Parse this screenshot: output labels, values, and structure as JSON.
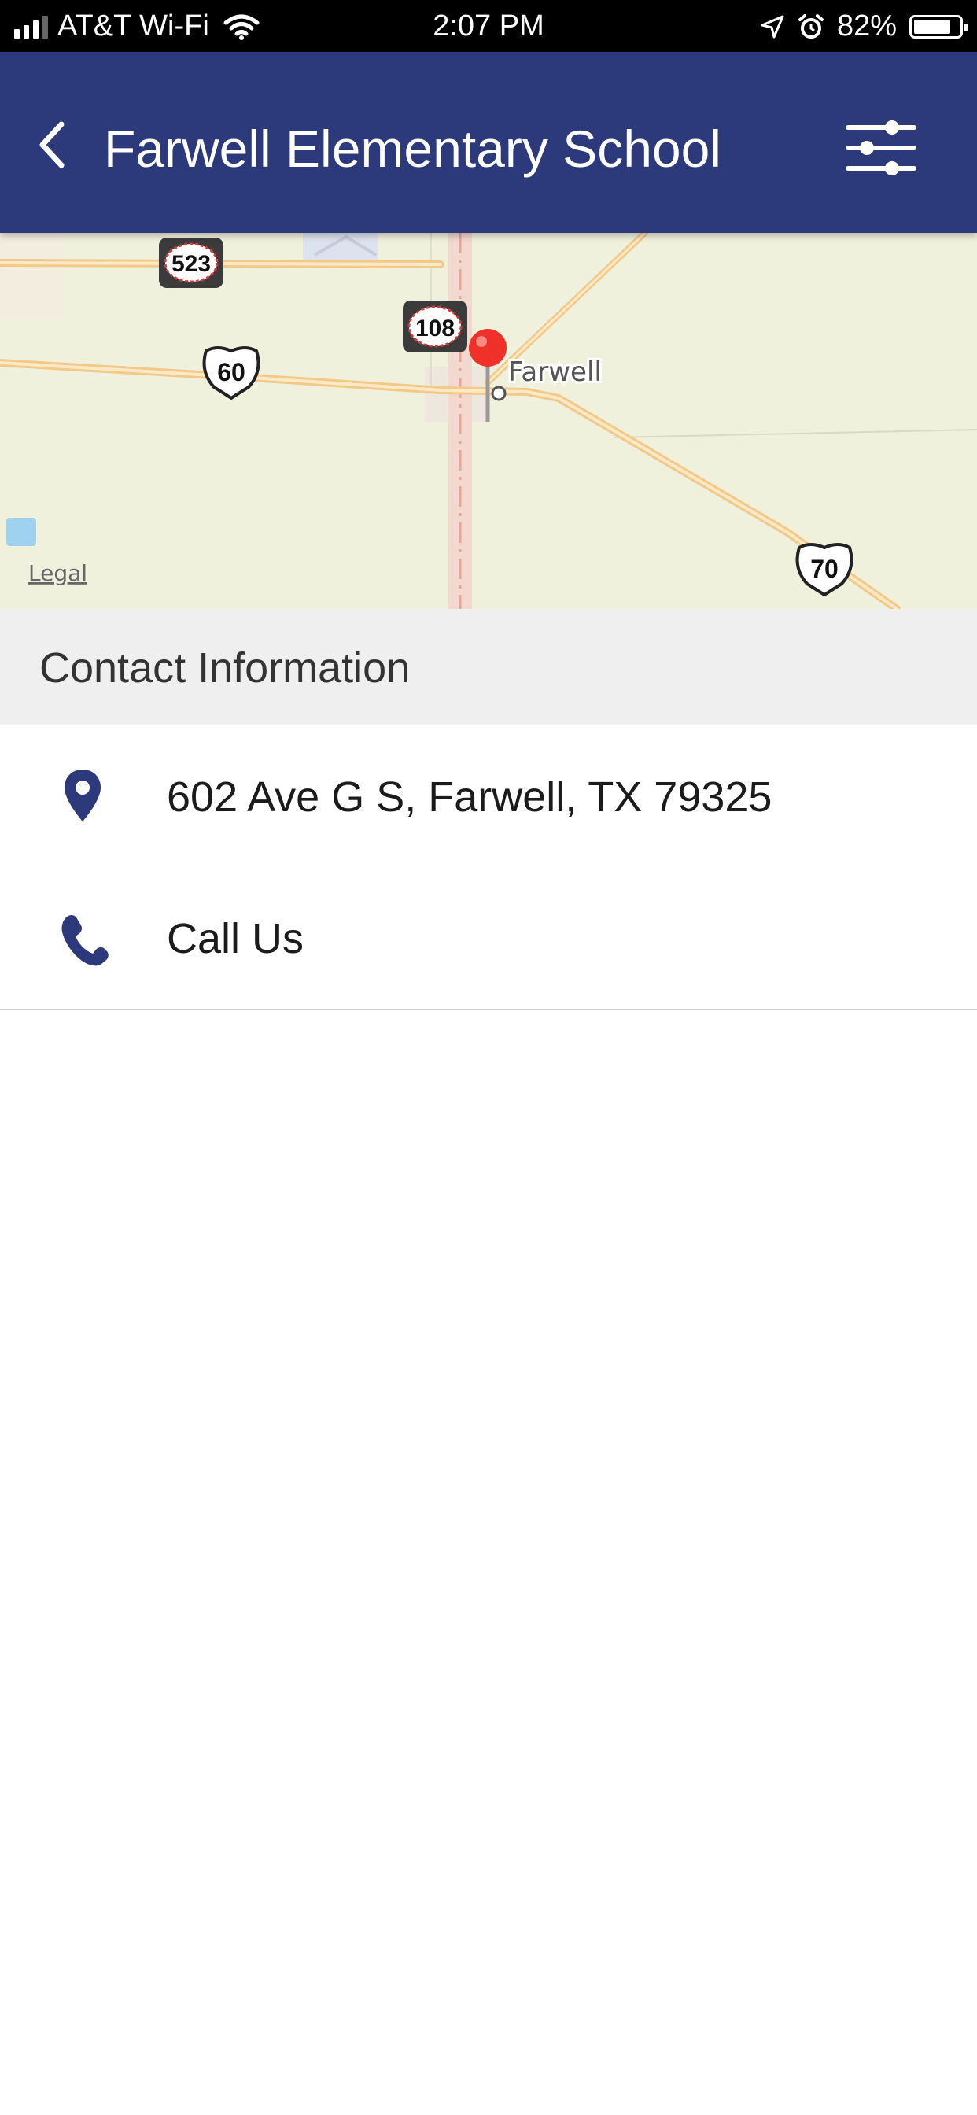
{
  "status_bar": {
    "carrier": "AT&T Wi-Fi",
    "time": "2:07 PM",
    "battery": "82%",
    "battery_level": 0.82
  },
  "nav": {
    "title": "Farwell Elementary School",
    "back_icon": "chevron-left-icon",
    "filter_icon": "sliders-icon"
  },
  "map": {
    "place_label": "Farwell",
    "legal_link": "Legal",
    "route_shields": [
      "523",
      "108",
      "60",
      "70"
    ]
  },
  "contact": {
    "section_title": "Contact Information",
    "address": "602 Ave G S, Farwell, TX 79325",
    "call_label": "Call Us",
    "address_icon": "map-pin-icon",
    "call_icon": "phone-icon"
  },
  "colors": {
    "primary": "#2c397a",
    "pin": "#f0312a",
    "map_land": "#eff1dc",
    "road": "#f3c98a",
    "section_bg": "#efefef"
  }
}
